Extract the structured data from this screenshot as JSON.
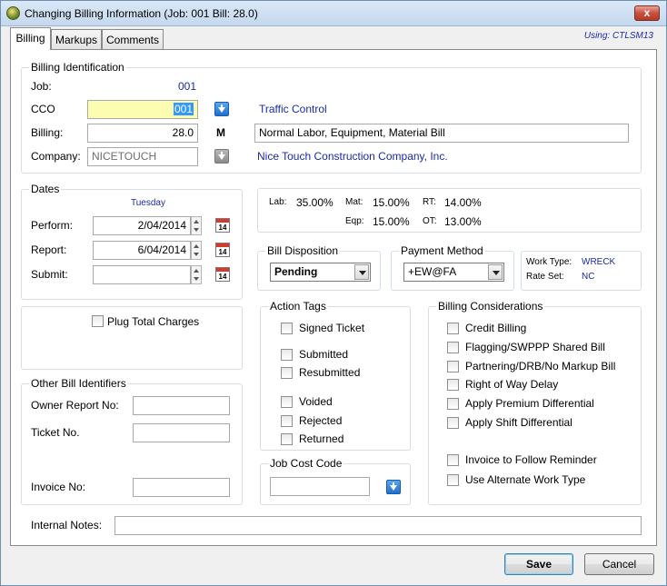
{
  "title": "Changing Billing Information  (Job: 001  Bill:   28.0)",
  "close_glyph": "x",
  "tabs": [
    {
      "label": "Billing"
    },
    {
      "label": "Markups"
    },
    {
      "label": "Comments"
    }
  ],
  "using": "Using:  CTLSM13",
  "billing_identification": {
    "group_label": "Billing Identification",
    "job_label": "Job:",
    "job_value": "001",
    "cco_label": "CCO",
    "cco_value": "001",
    "cco_description": "Traffic Control",
    "billing_label": "Billing:",
    "billing_value": "28.0",
    "billing_flag": "M",
    "billing_description": "Normal Labor, Equipment, Material Bill",
    "company_label": "Company:",
    "company_value": "NICETOUCH",
    "company_description": "Nice Touch Construction Company, Inc."
  },
  "dates": {
    "group_label": "Dates",
    "weekday": "Tuesday",
    "perform_label": "Perform:",
    "perform_value": "2/04/2014",
    "report_label": "Report:",
    "report_value": "6/04/2014",
    "submit_label": "Submit:",
    "submit_value": "",
    "calendar_day": "14"
  },
  "rates": {
    "lab_label": "Lab:",
    "lab_value": "35.00%",
    "mat_label": "Mat:",
    "mat_value": "15.00%",
    "rt_label": "RT:",
    "rt_value": "14.00%",
    "eqp_label": "Eqp:",
    "eqp_value": "15.00%",
    "ot_label": "OT:",
    "ot_value": "13.00%"
  },
  "bill_disposition": {
    "group_label": "Bill Disposition",
    "value": "Pending"
  },
  "payment_method": {
    "group_label": "Payment Method",
    "value": "+EW@FA"
  },
  "work_info": {
    "work_type_label": "Work Type:",
    "work_type_value": "WRECK",
    "rate_set_label": "Rate Set:",
    "rate_set_value": "NC"
  },
  "plug_total_charges": "Plug Total Charges",
  "other_bill_identifiers": {
    "group_label": "Other Bill Identifiers",
    "owner_report_label": "Owner Report No:",
    "owner_report_value": "",
    "ticket_label": "Ticket No.",
    "ticket_value": "",
    "invoice_label": "Invoice No:",
    "invoice_value": ""
  },
  "action_tags": {
    "group_label": "Action Tags",
    "items": [
      "Signed Ticket",
      "Submitted",
      "Resubmitted",
      "Voided",
      "Rejected",
      "Returned"
    ]
  },
  "job_cost_code": {
    "group_label": "Job Cost Code",
    "value": ""
  },
  "billing_considerations": {
    "group_label": "Billing Considerations",
    "items": [
      "Credit Billing",
      "Flagging/SWPPP Shared Bill",
      "Partnering/DRB/No Markup Bill",
      "Right of Way Delay",
      "Apply Premium Differential",
      "Apply Shift Differential",
      "Invoice to Follow Reminder",
      "Use Alternate Work Type"
    ]
  },
  "internal_notes": {
    "label": "Internal Notes:",
    "value": ""
  },
  "buttons": {
    "save": "Save",
    "cancel": "Cancel"
  },
  "colors": {
    "accent_blue": "#1a2aa8",
    "highlight_yellow": "#fdfdb1",
    "selection": "#3399ff"
  }
}
